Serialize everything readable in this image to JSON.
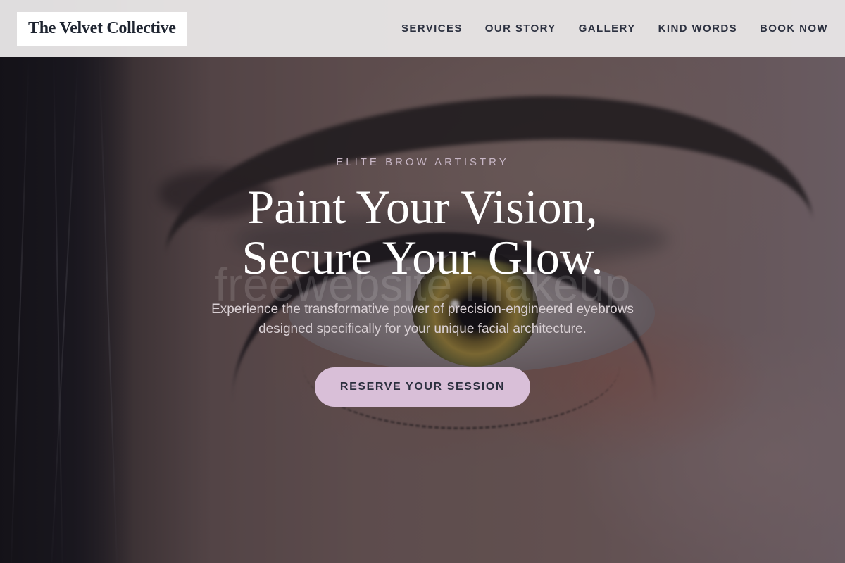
{
  "brand": {
    "name": "The Velvet Collective"
  },
  "nav": {
    "items": [
      {
        "label": "SERVICES"
      },
      {
        "label": "OUR STORY"
      },
      {
        "label": "GALLERY"
      },
      {
        "label": "KIND WORDS"
      },
      {
        "label": "BOOK NOW"
      }
    ]
  },
  "hero": {
    "eyebrow": "ELITE BROW ARTISTRY",
    "headline_line1": "Paint Your Vision,",
    "headline_line2": "Secure Your Glow.",
    "watermark": "freewebsite makeup",
    "subtext_line1": "Experience the transformative power of precision-engineered eyebrows",
    "subtext_line2": "designed specifically for your unique facial architecture.",
    "cta_label": "RESERVE YOUR SESSION",
    "background_image": "close-up eye with eyebrow"
  },
  "colors": {
    "cta_background": "#d9bfd8",
    "cta_text": "#2b2f3e",
    "nav_background": "#e8e6e6",
    "eyebrow_text": "#c8b7c6",
    "headline_text": "#ffffff"
  }
}
